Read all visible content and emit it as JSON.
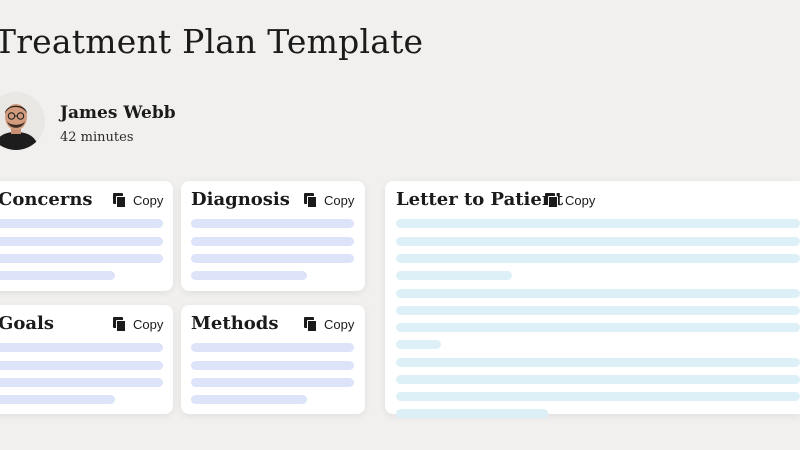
{
  "page": {
    "title": "Treatment Plan Template"
  },
  "author": {
    "name": "James Webb",
    "duration": "42 minutes"
  },
  "cards": {
    "concerns": {
      "title": "Concerns",
      "copy_label": "Copy"
    },
    "diagnosis": {
      "title": "Diagnosis",
      "copy_label": "Copy"
    },
    "goals": {
      "title": "Goals",
      "copy_label": "Copy"
    },
    "methods": {
      "title": "Methods",
      "copy_label": "Copy"
    },
    "letter": {
      "title": "Letter to Patient",
      "copy_label": "Copy"
    }
  },
  "colors": {
    "background": "#f1f0ee",
    "card": "#ffffff",
    "placeholder_line_blue": "#dde3f8",
    "placeholder_line_cyan": "#ddf0f7",
    "text": "#1b1b1b"
  },
  "icons": {
    "copy": "copy-icon",
    "avatar": "avatar"
  }
}
